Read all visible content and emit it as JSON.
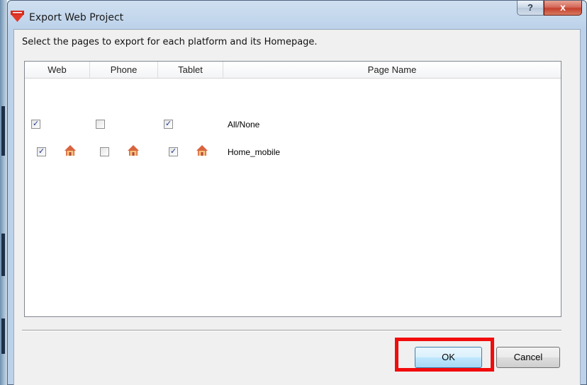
{
  "window": {
    "title": "Export Web Project",
    "help_label": "?",
    "close_label": "x"
  },
  "instruction": "Select the pages to export for each platform and its Homepage.",
  "table": {
    "columns": [
      "Web",
      "Phone",
      "Tablet",
      "Page Name"
    ],
    "rows": [
      {
        "page_name": "All/None",
        "web": true,
        "phone": false,
        "tablet": true,
        "home_icons": false
      },
      {
        "page_name": "Home_mobile",
        "web": true,
        "phone": false,
        "tablet": true,
        "home_icons": true
      }
    ]
  },
  "buttons": {
    "ok": "OK",
    "cancel": "Cancel"
  },
  "colors": {
    "highlight": "#f20c0c",
    "home_icon": "#c8543a",
    "check": "#21398c"
  }
}
